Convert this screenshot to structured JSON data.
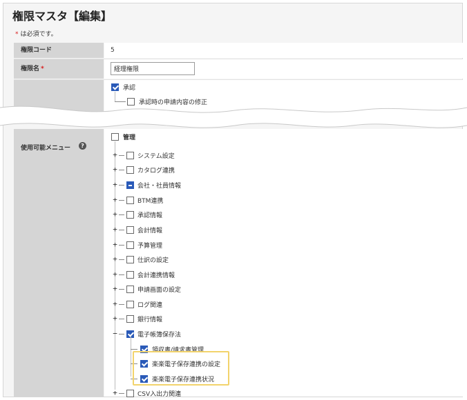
{
  "page": {
    "title": "権限マスタ【編集】",
    "required_star": "*",
    "required_note": "は必須です。"
  },
  "fields": {
    "code": {
      "label": "権限コード",
      "value": "5"
    },
    "name": {
      "label": "権限名",
      "required_star": "*",
      "value": "経理権限"
    },
    "menu": {
      "label": "使用可能メニュー",
      "help_icon": "?"
    }
  },
  "approval": {
    "item": {
      "label": "承認",
      "state": "checked"
    },
    "child": {
      "label": "承認時の申請内容の修正",
      "state": "unchecked"
    }
  },
  "tree": {
    "root": {
      "label": "管理",
      "state": "unchecked"
    },
    "expand_plus": "+",
    "expand_minus": "−",
    "items": [
      {
        "label": "システム設定",
        "state": "unchecked"
      },
      {
        "label": "カタログ連携",
        "state": "unchecked"
      },
      {
        "label": "会社・社員情報",
        "state": "partial"
      },
      {
        "label": "BTM連携",
        "state": "unchecked"
      },
      {
        "label": "承認情報",
        "state": "unchecked"
      },
      {
        "label": "会計情報",
        "state": "unchecked"
      },
      {
        "label": "予算管理",
        "state": "unchecked"
      },
      {
        "label": "仕訳の設定",
        "state": "unchecked"
      },
      {
        "label": "会計連携情報",
        "state": "unchecked"
      },
      {
        "label": "申請画面の設定",
        "state": "unchecked"
      },
      {
        "label": "ログ関連",
        "state": "unchecked"
      },
      {
        "label": "銀行情報",
        "state": "unchecked"
      },
      {
        "label": "電子帳簿保存法",
        "state": "checked",
        "expanded": true
      },
      {
        "label": "CSV入出力関連",
        "state": "unchecked"
      }
    ],
    "sub_items": [
      {
        "label": "領収書/請求書管理",
        "state": "checked"
      },
      {
        "label": "楽楽電子保存連携の設定",
        "state": "checked"
      },
      {
        "label": "楽楽電子保存連携状況",
        "state": "checked"
      }
    ]
  },
  "colors": {
    "checkbox_checked": "#2a5ab8",
    "required": "#d81b1b",
    "highlight": "#f2d36b",
    "label_bg": "#d5d5d5"
  }
}
